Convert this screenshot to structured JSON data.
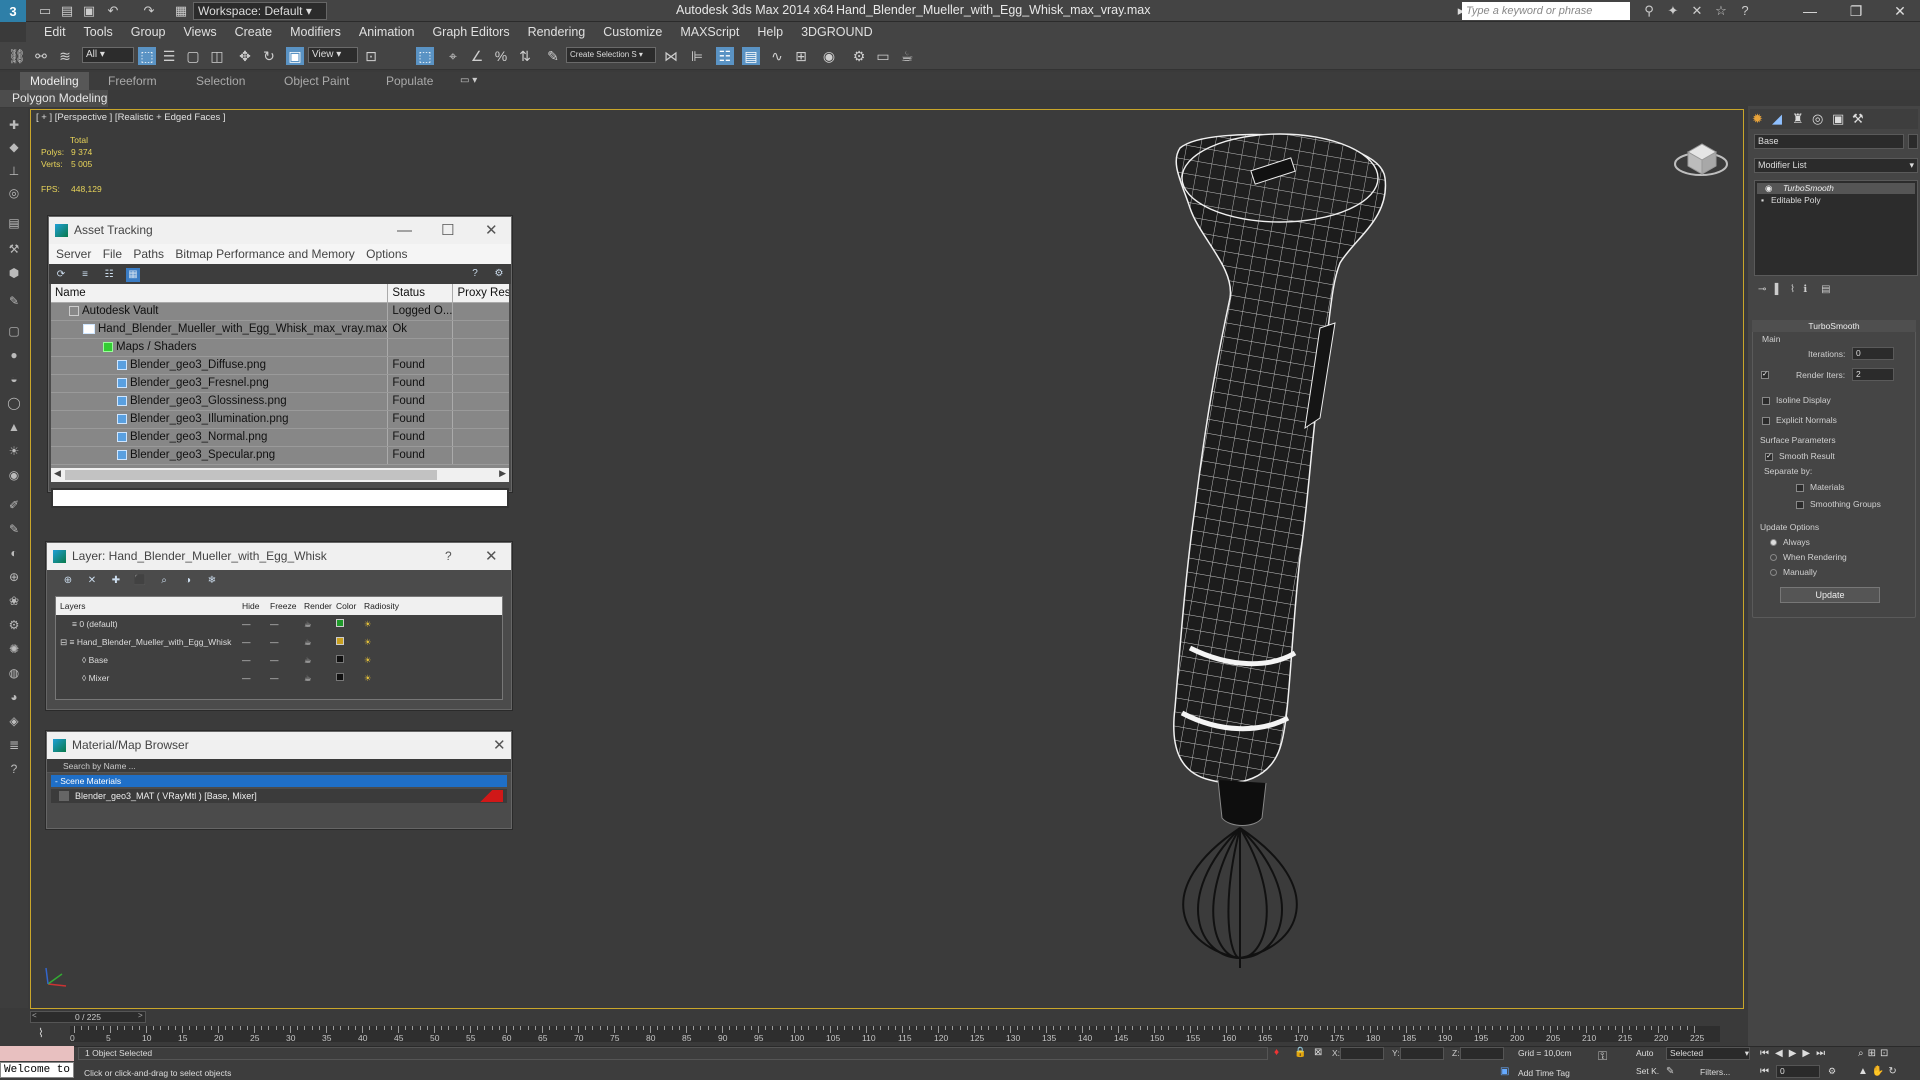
{
  "title_bar": {
    "app": "Autodesk 3ds Max  2014 x64",
    "document": "Hand_Blender_Mueller_with_Egg_Whisk_max_vray.max",
    "workspace": "Workspace: Default",
    "search_placeholder": "Type a keyword or phrase"
  },
  "menu": [
    "Edit",
    "Tools",
    "Group",
    "Views",
    "Create",
    "Modifiers",
    "Animation",
    "Graph Editors",
    "Rendering",
    "Customize",
    "MAXScript",
    "Help",
    "3DGROUND"
  ],
  "toolbar": {
    "selection_filter": "All",
    "ref_coord": "View",
    "named_selection": "Create Selection S"
  },
  "ribbon": {
    "tabs": [
      "Modeling",
      "Freeform",
      "Selection",
      "Object Paint",
      "Populate"
    ],
    "active_tab": "Modeling",
    "sub": "Polygon Modeling"
  },
  "viewport": {
    "label": "[ + ] [Perspective ] [Realistic + Edged Faces ]",
    "stats": {
      "total_label": "Total",
      "polys_label": "Polys:",
      "polys": "9 374",
      "verts_label": "Verts:",
      "verts": "5 005",
      "fps_label": "FPS:",
      "fps": "448,129"
    }
  },
  "asset_tracking": {
    "title": "Asset Tracking",
    "menu": [
      "Server",
      "File",
      "Paths",
      "Bitmap Performance and Memory",
      "Options"
    ],
    "columns": [
      "Name",
      "Status",
      "Proxy Res..."
    ],
    "rows": [
      {
        "name": "Autodesk Vault",
        "status": "Logged O..."
      },
      {
        "name": "Hand_Blender_Mueller_with_Egg_Whisk_max_vray.max",
        "status": "Ok"
      },
      {
        "name": "Maps / Shaders",
        "status": ""
      },
      {
        "name": "Blender_geo3_Diffuse.png",
        "status": "Found"
      },
      {
        "name": "Blender_geo3_Fresnel.png",
        "status": "Found"
      },
      {
        "name": "Blender_geo3_Glossiness.png",
        "status": "Found"
      },
      {
        "name": "Blender_geo3_Illumination.png",
        "status": "Found"
      },
      {
        "name": "Blender_geo3_Normal.png",
        "status": "Found"
      },
      {
        "name": "Blender_geo3_Specular.png",
        "status": "Found"
      }
    ]
  },
  "layer_panel": {
    "title": "Layer: Hand_Blender_Mueller_with_Egg_Whisk",
    "help": "?",
    "columns": [
      "Layers",
      "Hide",
      "Freeze",
      "Render",
      "Color",
      "Radiosity"
    ],
    "rows": [
      {
        "name": "0 (default)",
        "color": "#1f9a2a"
      },
      {
        "name": "Hand_Blender_Mueller_with_Egg_Whisk",
        "color": "#c8a020"
      },
      {
        "name": "Base",
        "color": "#111111"
      },
      {
        "name": "Mixer",
        "color": "#111111"
      }
    ]
  },
  "material_browser": {
    "title": "Material/Map Browser",
    "search_placeholder": "Search by Name ...",
    "group": "- Scene Materials",
    "item": "Blender_geo3_MAT  ( VRayMtl )  [Base, Mixer]"
  },
  "command_panel": {
    "object_name": "Base",
    "modifier_list": "Modifier List",
    "stack": [
      "TurboSmooth",
      "Editable Poly"
    ],
    "turbosmooth": {
      "title": "TurboSmooth",
      "main": "Main",
      "iterations_label": "Iterations:",
      "iterations": "0",
      "render_iters_label": "Render Iters:",
      "render_iters": "2",
      "isoline": "Isoline Display",
      "explicit": "Explicit Normals",
      "surface": "Surface Parameters",
      "smooth_result": "Smooth Result",
      "separate_by": "Separate by:",
      "materials": "Materials",
      "smoothing_groups": "Smoothing Groups",
      "update_options": "Update Options",
      "always": "Always",
      "when_rendering": "When Rendering",
      "manually": "Manually",
      "update_btn": "Update"
    }
  },
  "timeline": {
    "frame": "0 / 225",
    "ticks": [
      "0",
      "5",
      "10",
      "15",
      "20",
      "25",
      "30",
      "35",
      "40",
      "45",
      "50",
      "55",
      "60",
      "65",
      "70",
      "75",
      "80",
      "85",
      "90",
      "95",
      "100",
      "105",
      "110",
      "115",
      "120",
      "125",
      "130",
      "135",
      "140",
      "145",
      "150",
      "155",
      "160",
      "165",
      "170",
      "175",
      "180",
      "185",
      "190",
      "195",
      "200",
      "205",
      "210",
      "215",
      "220",
      "225"
    ]
  },
  "status": {
    "welcome": "Welcome to",
    "selected": "1 Object Selected",
    "hint": "Click or click-and-drag to select objects",
    "x_label": "X:",
    "y_label": "Y:",
    "z_label": "Z:",
    "grid": "Grid = 10,0cm",
    "add_time_tag": "Add Time Tag",
    "auto": "Auto",
    "set_key": "Set K.",
    "selected_dd": "Selected",
    "filters": "Filters...",
    "frame_field": "0"
  }
}
